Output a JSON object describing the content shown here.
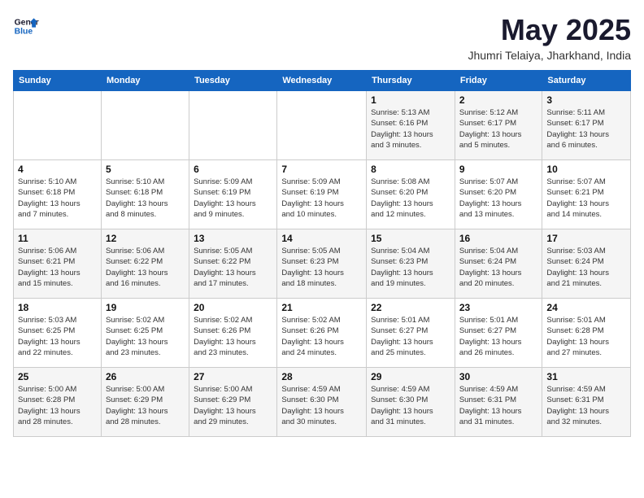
{
  "header": {
    "logo_line1": "General",
    "logo_line2": "Blue",
    "month_title": "May 2025",
    "location": "Jhumri Telaiya, Jharkhand, India"
  },
  "days_of_week": [
    "Sunday",
    "Monday",
    "Tuesday",
    "Wednesday",
    "Thursday",
    "Friday",
    "Saturday"
  ],
  "weeks": [
    [
      {
        "day": "",
        "info": ""
      },
      {
        "day": "",
        "info": ""
      },
      {
        "day": "",
        "info": ""
      },
      {
        "day": "",
        "info": ""
      },
      {
        "day": "1",
        "info": "Sunrise: 5:13 AM\nSunset: 6:16 PM\nDaylight: 13 hours\nand 3 minutes."
      },
      {
        "day": "2",
        "info": "Sunrise: 5:12 AM\nSunset: 6:17 PM\nDaylight: 13 hours\nand 5 minutes."
      },
      {
        "day": "3",
        "info": "Sunrise: 5:11 AM\nSunset: 6:17 PM\nDaylight: 13 hours\nand 6 minutes."
      }
    ],
    [
      {
        "day": "4",
        "info": "Sunrise: 5:10 AM\nSunset: 6:18 PM\nDaylight: 13 hours\nand 7 minutes."
      },
      {
        "day": "5",
        "info": "Sunrise: 5:10 AM\nSunset: 6:18 PM\nDaylight: 13 hours\nand 8 minutes."
      },
      {
        "day": "6",
        "info": "Sunrise: 5:09 AM\nSunset: 6:19 PM\nDaylight: 13 hours\nand 9 minutes."
      },
      {
        "day": "7",
        "info": "Sunrise: 5:09 AM\nSunset: 6:19 PM\nDaylight: 13 hours\nand 10 minutes."
      },
      {
        "day": "8",
        "info": "Sunrise: 5:08 AM\nSunset: 6:20 PM\nDaylight: 13 hours\nand 12 minutes."
      },
      {
        "day": "9",
        "info": "Sunrise: 5:07 AM\nSunset: 6:20 PM\nDaylight: 13 hours\nand 13 minutes."
      },
      {
        "day": "10",
        "info": "Sunrise: 5:07 AM\nSunset: 6:21 PM\nDaylight: 13 hours\nand 14 minutes."
      }
    ],
    [
      {
        "day": "11",
        "info": "Sunrise: 5:06 AM\nSunset: 6:21 PM\nDaylight: 13 hours\nand 15 minutes."
      },
      {
        "day": "12",
        "info": "Sunrise: 5:06 AM\nSunset: 6:22 PM\nDaylight: 13 hours\nand 16 minutes."
      },
      {
        "day": "13",
        "info": "Sunrise: 5:05 AM\nSunset: 6:22 PM\nDaylight: 13 hours\nand 17 minutes."
      },
      {
        "day": "14",
        "info": "Sunrise: 5:05 AM\nSunset: 6:23 PM\nDaylight: 13 hours\nand 18 minutes."
      },
      {
        "day": "15",
        "info": "Sunrise: 5:04 AM\nSunset: 6:23 PM\nDaylight: 13 hours\nand 19 minutes."
      },
      {
        "day": "16",
        "info": "Sunrise: 5:04 AM\nSunset: 6:24 PM\nDaylight: 13 hours\nand 20 minutes."
      },
      {
        "day": "17",
        "info": "Sunrise: 5:03 AM\nSunset: 6:24 PM\nDaylight: 13 hours\nand 21 minutes."
      }
    ],
    [
      {
        "day": "18",
        "info": "Sunrise: 5:03 AM\nSunset: 6:25 PM\nDaylight: 13 hours\nand 22 minutes."
      },
      {
        "day": "19",
        "info": "Sunrise: 5:02 AM\nSunset: 6:25 PM\nDaylight: 13 hours\nand 23 minutes."
      },
      {
        "day": "20",
        "info": "Sunrise: 5:02 AM\nSunset: 6:26 PM\nDaylight: 13 hours\nand 23 minutes."
      },
      {
        "day": "21",
        "info": "Sunrise: 5:02 AM\nSunset: 6:26 PM\nDaylight: 13 hours\nand 24 minutes."
      },
      {
        "day": "22",
        "info": "Sunrise: 5:01 AM\nSunset: 6:27 PM\nDaylight: 13 hours\nand 25 minutes."
      },
      {
        "day": "23",
        "info": "Sunrise: 5:01 AM\nSunset: 6:27 PM\nDaylight: 13 hours\nand 26 minutes."
      },
      {
        "day": "24",
        "info": "Sunrise: 5:01 AM\nSunset: 6:28 PM\nDaylight: 13 hours\nand 27 minutes."
      }
    ],
    [
      {
        "day": "25",
        "info": "Sunrise: 5:00 AM\nSunset: 6:28 PM\nDaylight: 13 hours\nand 28 minutes."
      },
      {
        "day": "26",
        "info": "Sunrise: 5:00 AM\nSunset: 6:29 PM\nDaylight: 13 hours\nand 28 minutes."
      },
      {
        "day": "27",
        "info": "Sunrise: 5:00 AM\nSunset: 6:29 PM\nDaylight: 13 hours\nand 29 minutes."
      },
      {
        "day": "28",
        "info": "Sunrise: 4:59 AM\nSunset: 6:30 PM\nDaylight: 13 hours\nand 30 minutes."
      },
      {
        "day": "29",
        "info": "Sunrise: 4:59 AM\nSunset: 6:30 PM\nDaylight: 13 hours\nand 31 minutes."
      },
      {
        "day": "30",
        "info": "Sunrise: 4:59 AM\nSunset: 6:31 PM\nDaylight: 13 hours\nand 31 minutes."
      },
      {
        "day": "31",
        "info": "Sunrise: 4:59 AM\nSunset: 6:31 PM\nDaylight: 13 hours\nand 32 minutes."
      }
    ]
  ]
}
